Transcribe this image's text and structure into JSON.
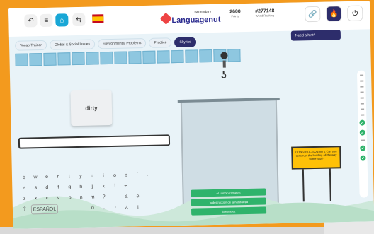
{
  "topbar": {
    "logo_sub": "Secondary",
    "logo_name": "Languagenut",
    "points_value": "2600",
    "points_label": "Points",
    "rank_value": "#277148",
    "rank_label": "World Ranking"
  },
  "tabs": [
    {
      "label": "Vocab Trainer"
    },
    {
      "label": "Global & Social Issues"
    },
    {
      "label": "Environmental Problems"
    },
    {
      "label": "Practice"
    },
    {
      "label": "Skyrise"
    }
  ],
  "need_hint_label": "Need a hint?",
  "word_card": "dirty",
  "keyboard": {
    "row1": [
      "q",
      "w",
      "e",
      "r",
      "t",
      "y",
      "u",
      "i",
      "o",
      "p",
      "´",
      "←"
    ],
    "row2": [
      "a",
      "s",
      "d",
      "f",
      "g",
      "h",
      "j",
      "k",
      "l",
      "↵"
    ],
    "row3": [
      "z",
      "x",
      "c",
      "v",
      "b",
      "n",
      "m",
      "?",
      ".",
      "á",
      "é",
      "!"
    ],
    "row4_caps": "⇧",
    "row4_space": "ESPAÑOL",
    "row4_keys": [
      "ó",
      ",",
      "-",
      "¿",
      "¡"
    ]
  },
  "floors": [
    {
      "label": "el cambio climático"
    },
    {
      "label": "la destrucción de la naturaleza"
    },
    {
      "label": "la escasez"
    }
  ],
  "sign_text": "CONSTRUCTION SITE Can you construct the building all the way to the roof?",
  "colors": {
    "accent": "#2d2d6b",
    "green": "#2fb36b",
    "frame": "#f39a1e"
  }
}
